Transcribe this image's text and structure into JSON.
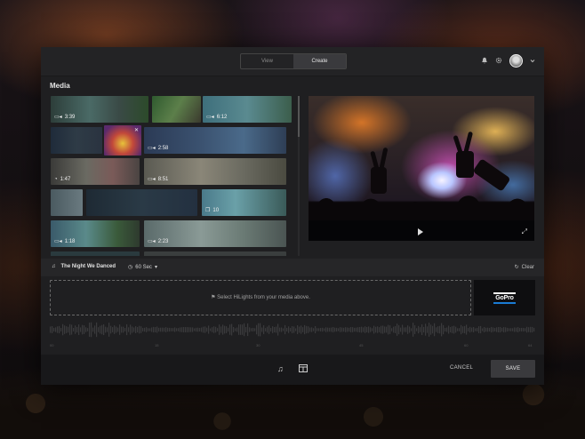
{
  "header": {
    "tabs": [
      {
        "label": "View",
        "active": false
      },
      {
        "label": "Create",
        "active": true
      }
    ],
    "icons": [
      "bell-icon",
      "gear-icon",
      "avatar",
      "chevron-down-icon"
    ]
  },
  "media": {
    "title": "Media",
    "clips": [
      {
        "duration": "3:39",
        "icon": "video-icon"
      },
      {
        "duration": "6:12",
        "icon": "video-icon"
      },
      {
        "duration": "",
        "icon": "video-icon"
      },
      {
        "duration": "2:58",
        "icon": "video-icon"
      },
      {
        "duration": "1:47",
        "icon": "timelapse-icon"
      },
      {
        "duration": "8:51",
        "icon": "video-icon"
      },
      {
        "duration": "",
        "icon": "video-icon"
      },
      {
        "duration": "10",
        "icon": "photo-burst-icon"
      },
      {
        "duration": "1:18",
        "icon": "video-icon"
      },
      {
        "duration": "2:23",
        "icon": "video-icon"
      }
    ]
  },
  "soundtrack": {
    "song": "The Night We Danced",
    "duration": "60 Sec",
    "clear_label": "Clear"
  },
  "hilights": {
    "message": "Select HiLights from your media above."
  },
  "brand": {
    "logo_text": "GoPro",
    "accent": "#1a7bd3"
  },
  "timeline": {
    "ticks": [
      "00",
      "15",
      "30",
      "45",
      "60",
      "64"
    ]
  },
  "footer": {
    "cancel_label": "CANCEL",
    "save_label": "SAVE",
    "icons": [
      "music-icon",
      "layout-icon"
    ]
  }
}
